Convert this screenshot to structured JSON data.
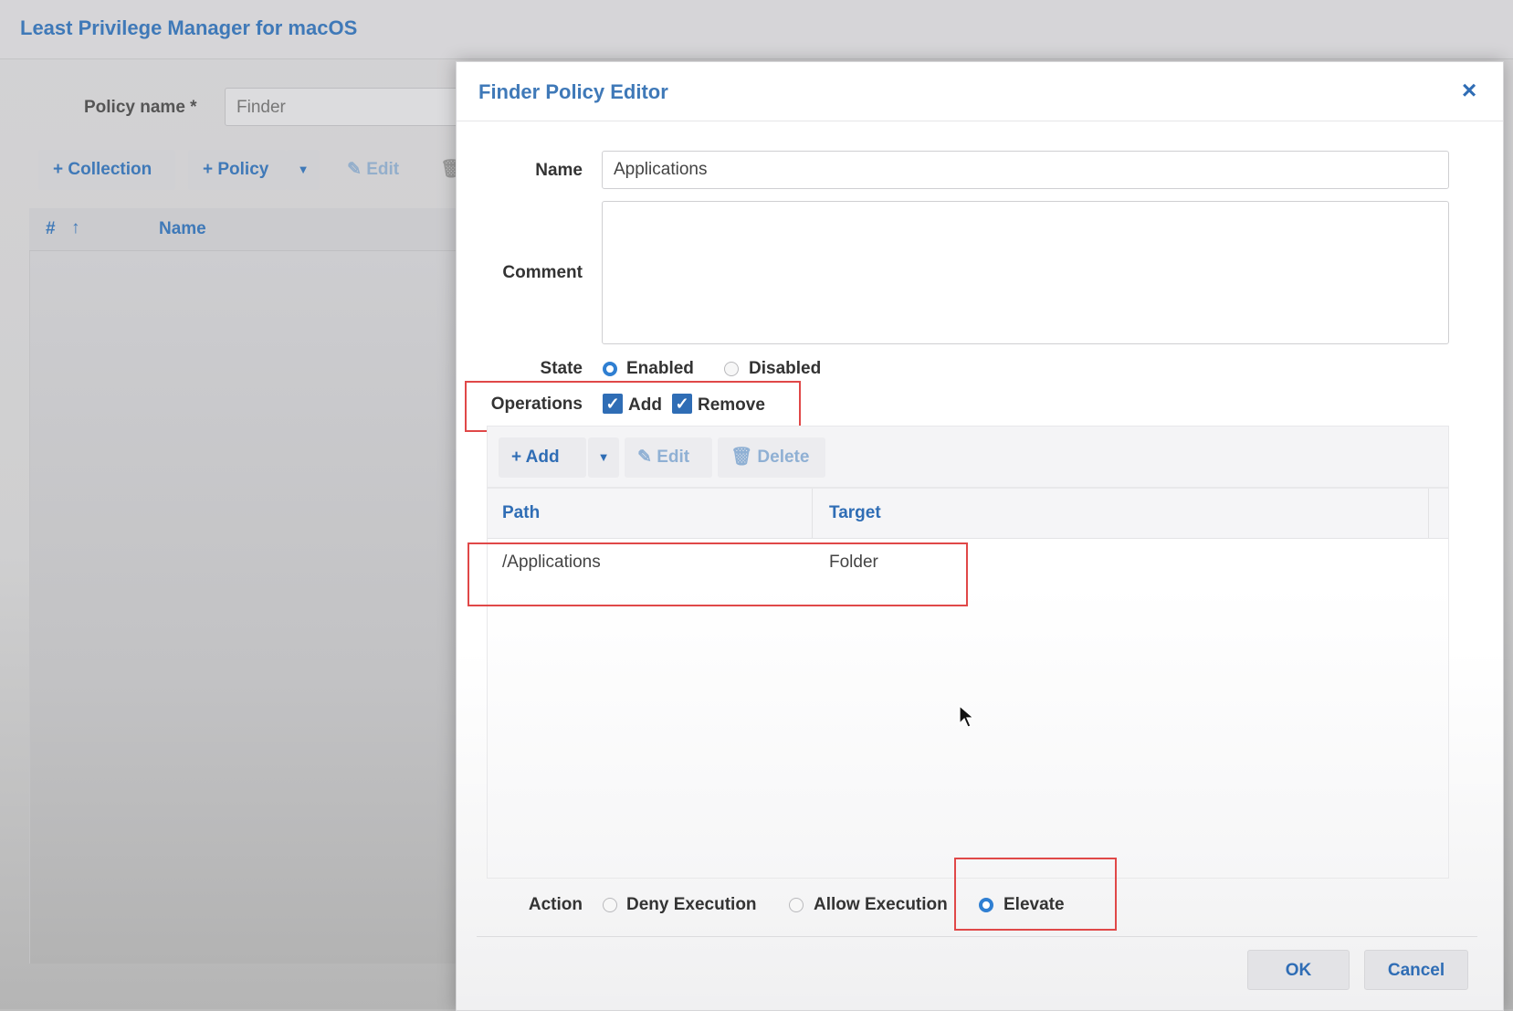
{
  "app": {
    "title": "Least Privilege Manager for macOS",
    "policy_name_label": "Policy name *",
    "policy_name_value": "Finder",
    "toolbar": {
      "collection": "+ Collection",
      "policy": "+ Policy",
      "edit": "Edit"
    },
    "grid": {
      "col_number": "#",
      "col_name": "Name"
    }
  },
  "dialog": {
    "title": "Finder Policy Editor",
    "close": "×",
    "name_label": "Name",
    "name_value": "Applications",
    "comment_label": "Comment",
    "comment_value": "",
    "state_label": "State",
    "state_options": [
      "Enabled",
      "Disabled"
    ],
    "state_selected": "Enabled",
    "operations_label": "Operations",
    "operations": [
      {
        "label": "Add",
        "checked": true
      },
      {
        "label": "Remove",
        "checked": true
      }
    ],
    "toolbar": {
      "add": "Add",
      "edit": "Edit",
      "delete": "Delete"
    },
    "table": {
      "columns": [
        "Path",
        "Target"
      ],
      "rows": [
        {
          "path": "/Applications",
          "target": "Folder"
        }
      ]
    },
    "action_label": "Action",
    "action_options": [
      "Deny Execution",
      "Allow Execution",
      "Elevate"
    ],
    "action_selected": "Elevate",
    "ok": "OK",
    "cancel": "Cancel"
  },
  "colors": {
    "accent": "#2f6db5",
    "highlight": "#e04848"
  }
}
